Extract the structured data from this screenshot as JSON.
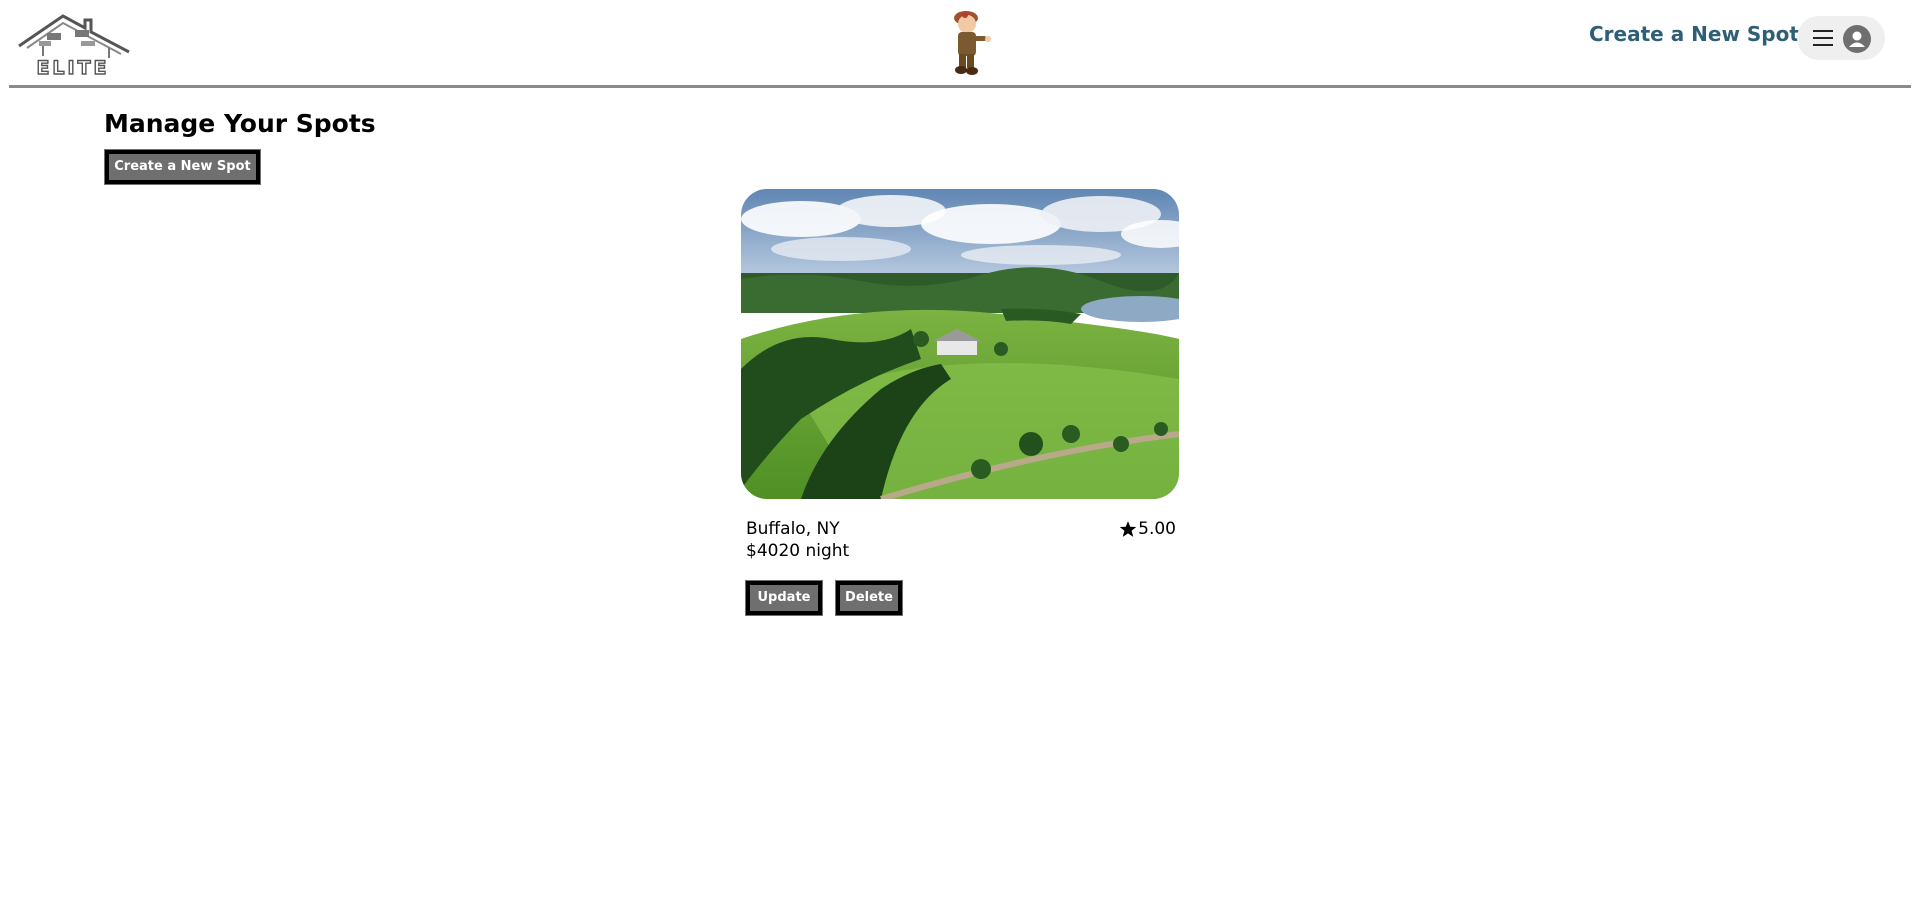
{
  "header": {
    "logo_text": "ELITE",
    "create_link_label": "Create a New Spot",
    "icons": {
      "menu": "hamburger-menu-icon",
      "user": "user-avatar-icon",
      "mascot": "mascot-icon"
    }
  },
  "main": {
    "title": "Manage Your Spots",
    "create_button_label": "Create a New Spot"
  },
  "spots": [
    {
      "location": "Buffalo, NY",
      "rating": "5.00",
      "price": "$4020 night",
      "update_label": "Update",
      "delete_label": "Delete"
    }
  ],
  "colors": {
    "link": "#2e5f77",
    "button_bg": "#6f6f6f",
    "button_border": "#000000",
    "divider": "#8a8a8a"
  }
}
